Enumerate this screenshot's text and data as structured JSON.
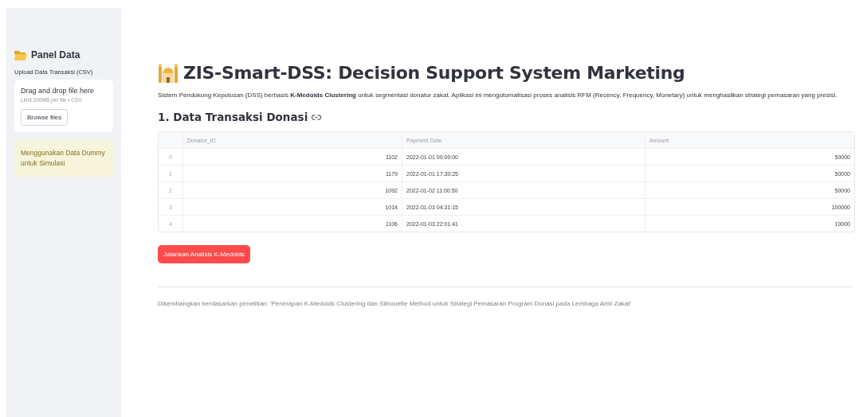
{
  "sidebar": {
    "title": "Panel Data",
    "upload_label": "Upload Data Transaksi (CSV)",
    "dropzone": {
      "title": "Drag and drop file here",
      "hint": "Limit 200MB per file • CSV",
      "button": "Browse files"
    },
    "notice": "Menggunakan Data Dummy untuk Simulasi"
  },
  "header": {
    "title": "ZIS-Smart-DSS: Decision Support System Marketing",
    "description": "Sistem Pendukung Keputusan (DSS) berbasis **K-Medoids Clustering** untuk segmentasi donatur zakat. Aplikasi ini mengotomatisasi proses analisis RFM (Recency, Frequency, Monetary) untuk menghasilkan strategi pemasaran yang presisi."
  },
  "section": {
    "title": "1. Data Transaksi Donasi"
  },
  "table": {
    "columns": [
      "Donatur_ID",
      "Payment Date",
      "Amount"
    ],
    "rows": [
      {
        "index": "0",
        "cells": [
          "1102",
          "2022-01-01 00:00:00",
          "50000"
        ]
      },
      {
        "index": "1",
        "cells": [
          "1179",
          "2022-01-01 17:30:25",
          "50000"
        ]
      },
      {
        "index": "2",
        "cells": [
          "1092",
          "2022-01-02 11:00:50",
          "50000"
        ]
      },
      {
        "index": "3",
        "cells": [
          "1014",
          "2022-01-03 04:31:15",
          "100000"
        ]
      },
      {
        "index": "4",
        "cells": [
          "1106",
          "2022-01-03 22:01:41",
          "10000"
        ]
      }
    ]
  },
  "run_button": "Jalankan Analisis K-Medoids",
  "footer": "Dikembangkan berdasarkan penelitian: 'Penerapan K-Medoids Clustering dan Silhouette Method untuk Strategi Pemasaran Program Donasi pada Lembaga Amil Zakat'"
}
